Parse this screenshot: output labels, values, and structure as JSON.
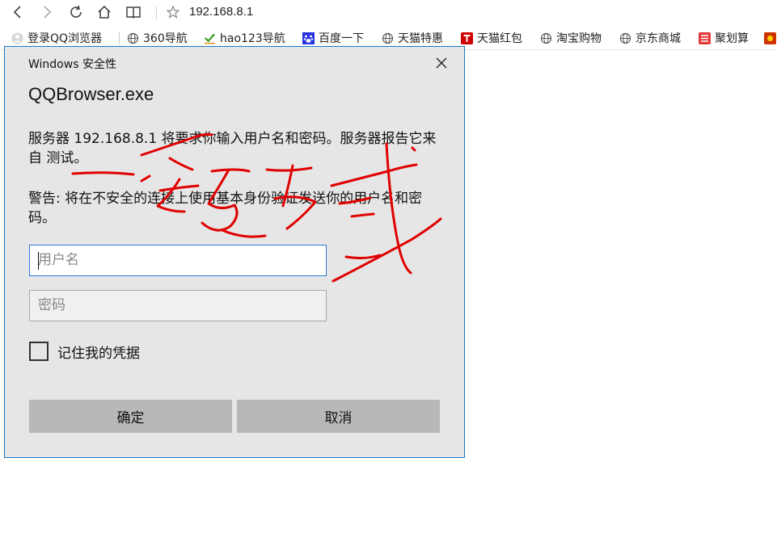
{
  "browser": {
    "address": "192.168.8.1",
    "bookmarks": [
      {
        "label": "登录QQ浏览器",
        "icon": "user-icon"
      },
      {
        "label": "360导航",
        "icon": "globe-icon"
      },
      {
        "label": "hao123导航",
        "icon": "hao123-icon"
      },
      {
        "label": "百度一下",
        "icon": "baidu-paw-icon"
      },
      {
        "label": "天猫特惠",
        "icon": "globe-icon"
      },
      {
        "label": "天猫红包",
        "icon": "tmall-icon"
      },
      {
        "label": "淘宝购物",
        "icon": "globe-icon"
      },
      {
        "label": "京东商城",
        "icon": "globe-icon"
      },
      {
        "label": "聚划算",
        "icon": "juhuasuan-icon"
      }
    ],
    "colors": {
      "tmall": "#cc0000",
      "baidu": "#2932e1",
      "juhuasuan": "#e4393c",
      "hao": "#3a9d23"
    }
  },
  "dialog": {
    "title": "Windows 安全性",
    "app": "QQBrowser.exe",
    "message": "服务器 192.168.8.1 将要求你输入用户名和密码。服务器报告它来自 测试。",
    "warning": "警告: 将在不安全的连接上使用基本身份验证发送你的用户名和密码。",
    "username_placeholder": "用户名",
    "password_placeholder": "密码",
    "remember_label": "记住我的凭据",
    "ok_label": "确定",
    "cancel_label": "取消",
    "border_color": "#1979ca",
    "annotation_color": "#e00000"
  }
}
